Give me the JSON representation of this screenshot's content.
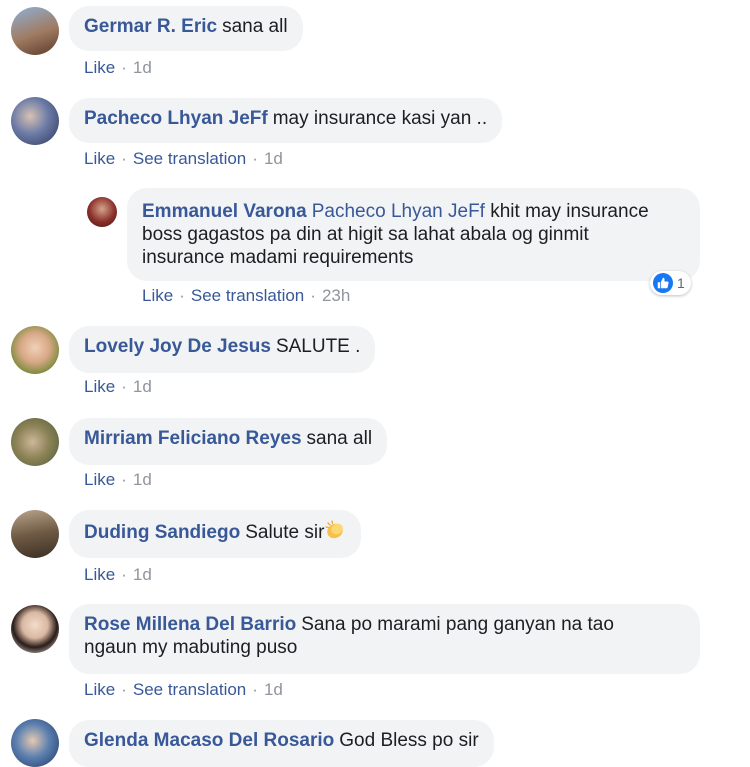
{
  "comments": [
    {
      "author": "Germar R. Eric",
      "text": "sana all",
      "actions": [
        "Like"
      ],
      "time": "1d"
    },
    {
      "author": "Pacheco Lhyan JeFf",
      "text": "may insurance kasi yan ..",
      "actions": [
        "Like",
        "See translation"
      ],
      "time": "1d"
    },
    {
      "author": "Emmanuel Varona",
      "mention": "Pacheco Lhyan JeFf",
      "text_line1": "khit may insurance",
      "text_line2": "boss gagastos pa din at higit sa lahat abala og ginmit",
      "text_line3": "insurance madami requirements",
      "actions": [
        "Like",
        "See translation"
      ],
      "time": "23h",
      "reaction_count": "1",
      "reaction_icon": "like-icon"
    },
    {
      "author": "Lovely Joy De Jesus",
      "text": "SALUTE .",
      "actions": [
        "Like"
      ],
      "time": "1d"
    },
    {
      "author": "Mirriam Feliciano Reyes",
      "text": "sana all",
      "actions": [
        "Like"
      ],
      "time": "1d"
    },
    {
      "author": "Duding Sandiego",
      "text": "Salute sir",
      "emoji": "clapping-hands-icon",
      "actions": [
        "Like"
      ],
      "time": "1d"
    },
    {
      "author": "Rose Millena Del Barrio",
      "text_line1": "Sana po marami pang ganyan na tao",
      "text_line2": "ngaun my mabuting puso",
      "actions": [
        "Like",
        "See translation"
      ],
      "time": "1d"
    },
    {
      "author": "Glenda Macaso Del Rosario",
      "text": "God Bless po sir"
    }
  ],
  "colors": {
    "link": "#385898",
    "bubble": "#f2f3f5",
    "meta": "#90949c",
    "like_blue": "#1877f2"
  }
}
